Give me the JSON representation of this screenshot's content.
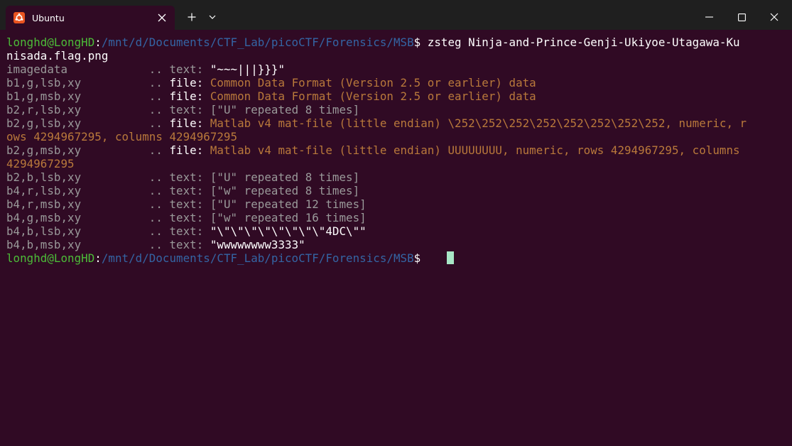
{
  "tab": {
    "title": "Ubuntu"
  },
  "prompt": {
    "user_host": "longhd@LongHD",
    "colon": ":",
    "path": "/mnt/d/Documents/CTF_Lab/picoCTF/Forensics/MSB",
    "symbol": "$"
  },
  "command": {
    "line1": " zsteg Ninja-and-Prince-Genji-Ukiyoe-Utagawa-Ku",
    "line2": "nisada.flag.png"
  },
  "rows": [
    {
      "key": "imagedata           ",
      "sep": " .. ",
      "kind": "text:",
      "val": " \"~~~|||}}}\""
    },
    {
      "key": "b1,g,lsb,xy         ",
      "sep": " .. ",
      "kind": "file:",
      "val": " Common Data Format (Version 2.5 or earlier) data"
    },
    {
      "key": "b1,g,msb,xy         ",
      "sep": " .. ",
      "kind": "file:",
      "val": " Common Data Format (Version 2.5 or earlier) data"
    },
    {
      "key": "b2,r,lsb,xy         ",
      "sep": " .. ",
      "kind": "text:",
      "val": " [\"U\" repeated 8 times]"
    },
    {
      "key": "b2,g,lsb,xy         ",
      "sep": " .. ",
      "kind": "file:",
      "val": " Matlab v4 mat-file (little endian) \\252\\252\\252\\252\\252\\252\\252\\252, numeric, r",
      "cont": "ows 4294967295, columns 4294967295"
    },
    {
      "key": "b2,g,msb,xy         ",
      "sep": " .. ",
      "kind": "file:",
      "val": " Matlab v4 mat-file (little endian) UUUUUUUU, numeric, rows 4294967295, columns",
      "cont": "4294967295"
    },
    {
      "key": "b2,b,lsb,xy         ",
      "sep": " .. ",
      "kind": "text:",
      "val": " [\"U\" repeated 8 times]"
    },
    {
      "key": "b4,r,lsb,xy         ",
      "sep": " .. ",
      "kind": "text:",
      "val": " [\"w\" repeated 8 times]"
    },
    {
      "key": "b4,r,msb,xy         ",
      "sep": " .. ",
      "kind": "text:",
      "val": " [\"U\" repeated 12 times]"
    },
    {
      "key": "b4,g,msb,xy         ",
      "sep": " .. ",
      "kind": "text:",
      "val": " [\"w\" repeated 16 times]"
    },
    {
      "key": "b4,b,lsb,xy         ",
      "sep": " .. ",
      "kind": "text:",
      "val": " \"\\\"\\\"\\\"\\\"\\\"\\\"\\\"\\\"4DC\\\"\""
    },
    {
      "key": "b4,b,msb,xy         ",
      "sep": " .. ",
      "kind": "text:",
      "val": " \"wwwwwwww3333\""
    }
  ],
  "colors": {
    "background": "#300a24",
    "titlebar": "#1f1f1f",
    "user_host": "#4cbc38",
    "path": "#3465a4",
    "dim_text": "#9a9a9a",
    "file_value": "#b9793b",
    "cursor": "#a8e6c6",
    "ubuntu_orange": "#e95420"
  },
  "icons": {
    "tab_icon": "ubuntu-logo",
    "tab_close": "close-icon",
    "new_tab": "plus-icon",
    "dropdown": "chevron-down-icon",
    "minimize": "minimize-icon",
    "maximize": "maximize-icon",
    "close": "close-icon"
  }
}
